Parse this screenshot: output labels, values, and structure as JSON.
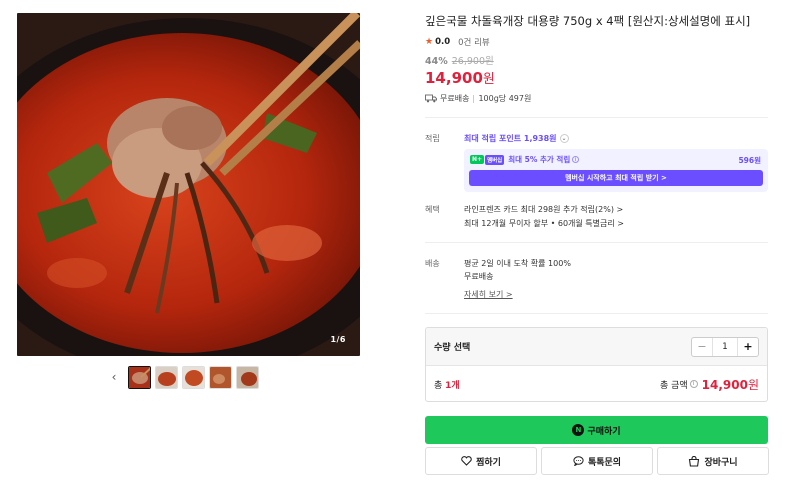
{
  "gallery": {
    "page_indicator": "1/6",
    "thumbnail_count": 5,
    "active_thumbnail": 1
  },
  "product": {
    "title": "깊은국물 차돌육개장 대용량 750g x 4팩 [원산지:상세설명에 표시]",
    "rating": "0.0",
    "review_count": "0건 리뷰",
    "discount_rate": "44%",
    "original_price": "26,900원",
    "price": "14,900",
    "price_unit": "원",
    "shipping": "무료배송",
    "unit_price": "100g당 497원"
  },
  "points": {
    "label": "적립",
    "max_points": "최대 적립 포인트 1,938원",
    "membership_text": "최대 5% 추가 적립",
    "membership_amount": "596원",
    "membership_button": "멤버십 시작하고 최대 적립 받기 >",
    "npay_badge": "N+",
    "membership_badge": "멤버십"
  },
  "benefits": {
    "label": "혜택",
    "line1": "라인프렌즈 카드 최대 298원 추가 적립(2%) >",
    "line2": "최대 12개월 무이자 할부 • 60개월 특별금리 >"
  },
  "delivery": {
    "label": "배송",
    "line1": "평균 2일 이내 도착 확률 100%",
    "line2": "무료배송",
    "details_link": "자세히 보기 >"
  },
  "quantity": {
    "label": "수량 선택",
    "value": "1",
    "total_count_prefix": "총 ",
    "total_count": "1개",
    "total_price_label": "총 금액",
    "total_price": "14,900",
    "total_price_unit": "원"
  },
  "actions": {
    "buy": "구매하기",
    "wishlist": "찜하기",
    "talk": "톡톡문의",
    "cart": "장바구니"
  },
  "colors": {
    "price_red": "#e3203b",
    "naver_green": "#1ec85a",
    "membership_purple": "#6b4eff"
  }
}
